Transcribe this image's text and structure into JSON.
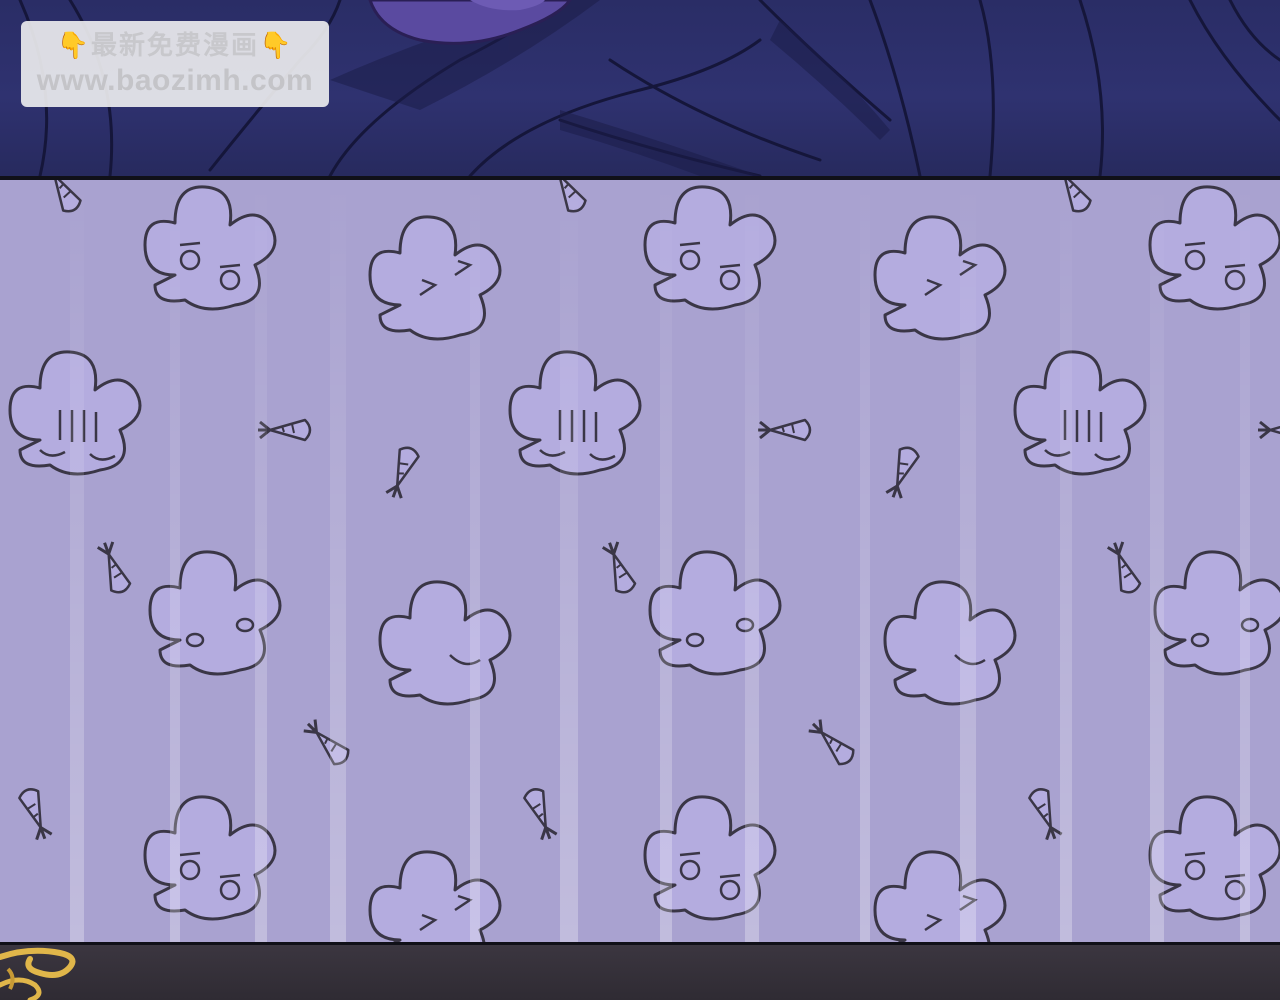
{
  "watermark": {
    "pointer_left": "👇",
    "line1": "最新免费漫画",
    "pointer_right": "👇",
    "line2": "www.baozimh.com"
  },
  "colors": {
    "top_panel": "#2f3270",
    "pattern_background": "#a9a2d0",
    "doodle_fill": "#b4acdf",
    "doodle_outline": "#3a3646",
    "bottom_strip": "#35313a",
    "ornament_gold": "#e0b64a"
  },
  "icons": {
    "pointer": "pointing-down-hand-icon",
    "doodles": [
      "bunny-head-doodle",
      "carrot-doodle"
    ],
    "ornament": "gold-scroll-ornament"
  }
}
